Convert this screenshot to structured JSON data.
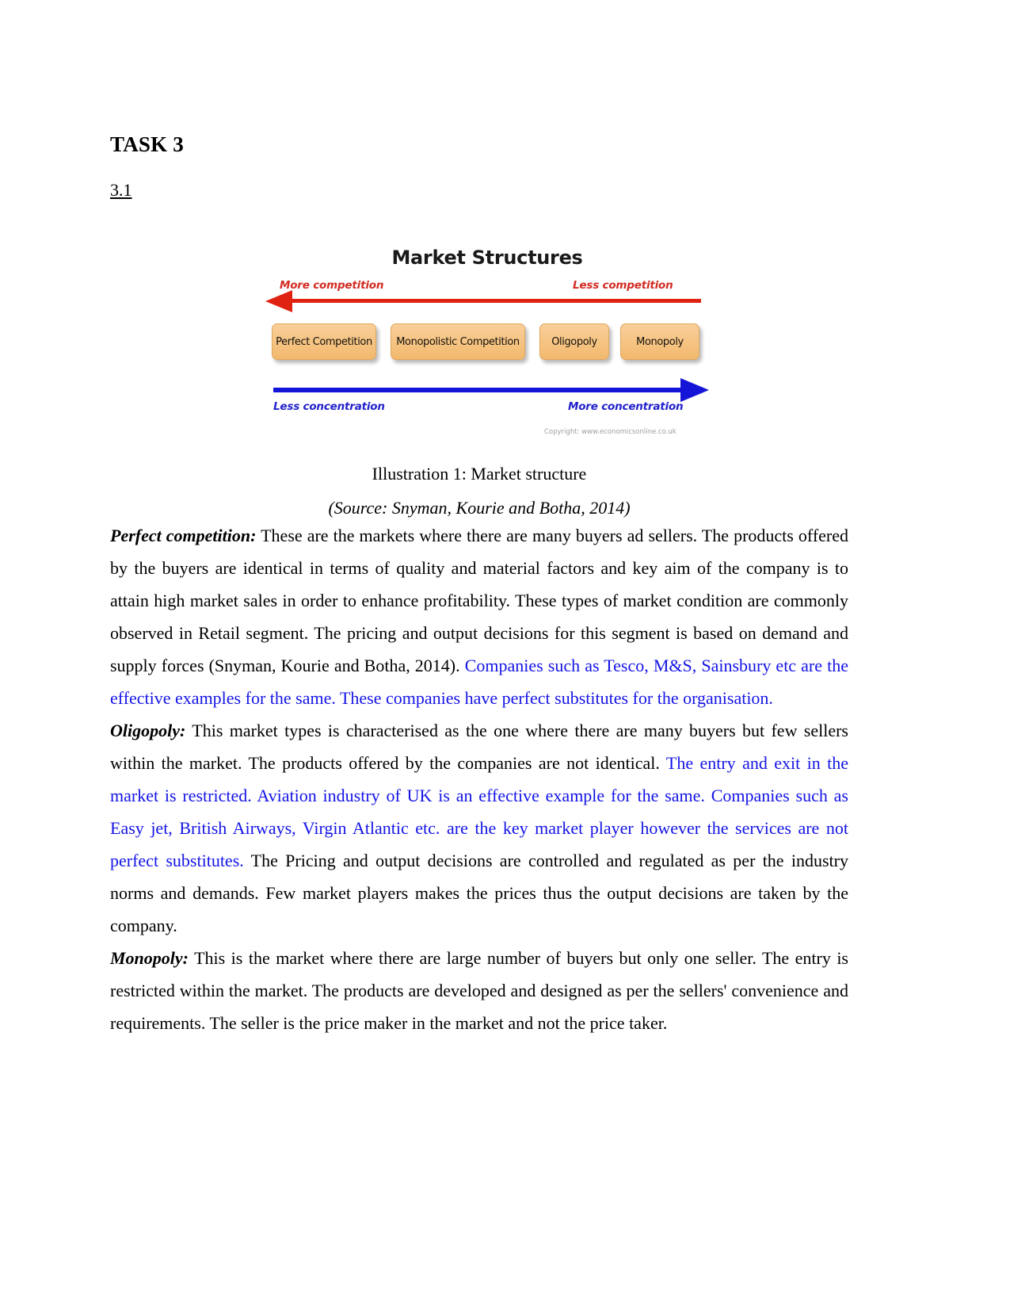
{
  "document": {
    "task_heading": "TASK 3",
    "sub_heading": "3.1"
  },
  "figure": {
    "title": "Market Structures",
    "label_more_competition": "More competition",
    "label_less_competition": "Less competition",
    "label_less_concentration": "Less concentration",
    "label_more_concentration": "More concentration",
    "boxes": [
      {
        "label": "Perfect Competition"
      },
      {
        "label": "Monopolistic Competition"
      },
      {
        "label": "Oligopoly"
      },
      {
        "label": "Monopoly"
      }
    ],
    "copyright": "Copyright: www.economicsonline.co.uk",
    "caption": "Illustration 1: Market structure",
    "source": "(Source: Snyman, Kourie and Botha, 2014)",
    "colors": {
      "competition_arrow": "#e02213",
      "concentration_arrow": "#1515d8",
      "box_fill": "#f2b96e"
    }
  },
  "paragraphs": {
    "perfect_competition": {
      "lead": "Perfect competition:",
      "black_1": " These are the markets where there are many buyers ad sellers. The products offered by the buyers are identical in terms of quality and material factors and key aim of the company is to attain high market sales in order to enhance profitability. These types of market condition are commonly observed in Retail segment. The pricing and output decisions for this segment is based on demand and supply forces (Snyman, Kourie and Botha, 2014). ",
      "blue_1": "Companies such as Tesco, M&S, Sainsbury etc are the effective examples for the same. These companies have perfect substitutes for the organisation."
    },
    "oligopoly": {
      "lead": "Oligopoly:",
      "black_1": " This market types is characterised as the one where there are many buyers but few sellers within the market. The products offered by the companies are not identical. ",
      "blue_1": "The entry and exit in the market is restricted. Aviation industry of UK is an effective example for the same. Companies such as Easy jet, British Airways, Virgin Atlantic etc. are the key market player however the services are not perfect substitutes.",
      "black_2": " The Pricing and output decisions are controlled and regulated as per the industry norms and demands. Few market players makes the prices thus the output decisions are taken by the company."
    },
    "monopoly": {
      "lead": "Monopoly:",
      "black_1": " This is the market where there are large number of buyers but only one seller. The entry is restricted within the market. The products are developed and designed as per the sellers' convenience and requirements. The seller is the price maker in the market and not the price taker."
    }
  },
  "colors": {
    "text_black": "#000000",
    "text_blue": "#1414e6",
    "page_background": "#ffffff"
  }
}
